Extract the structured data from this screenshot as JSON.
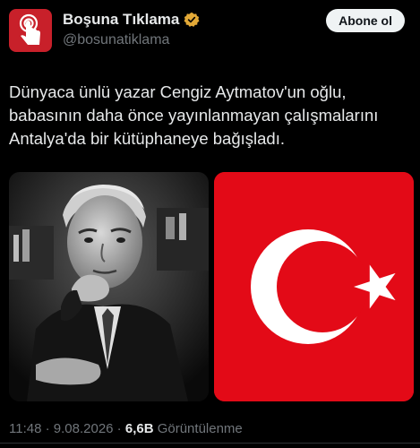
{
  "account": {
    "display_name": "Boşuna Tıklama",
    "handle": "@bosunatiklama",
    "avatar_icon": "tap-finger-icon",
    "verified_icon": "verified-badge-icon",
    "brand_color": "#c8202a",
    "badge_color": "#e3a937"
  },
  "actions": {
    "follow_label": "Abone ol"
  },
  "tweet": {
    "text_lines": [
      "Dünyaca ünlü yazar Cengiz Aytmatov'un oğlu,",
      "babasının daha önce yayınlanmayan çalışmalarını",
      "Antalya'da bir kütüphaneye bağışladı."
    ]
  },
  "media": [
    {
      "kind": "photo",
      "icon": "portrait-photo"
    },
    {
      "kind": "flag",
      "icon": "turkey-flag",
      "color": "#e30a17"
    }
  ],
  "meta": {
    "time": "11:48",
    "separator": " · ",
    "date": "9.08.2026",
    "views_count": "6,6B",
    "views_label": " Görüntülenme"
  }
}
